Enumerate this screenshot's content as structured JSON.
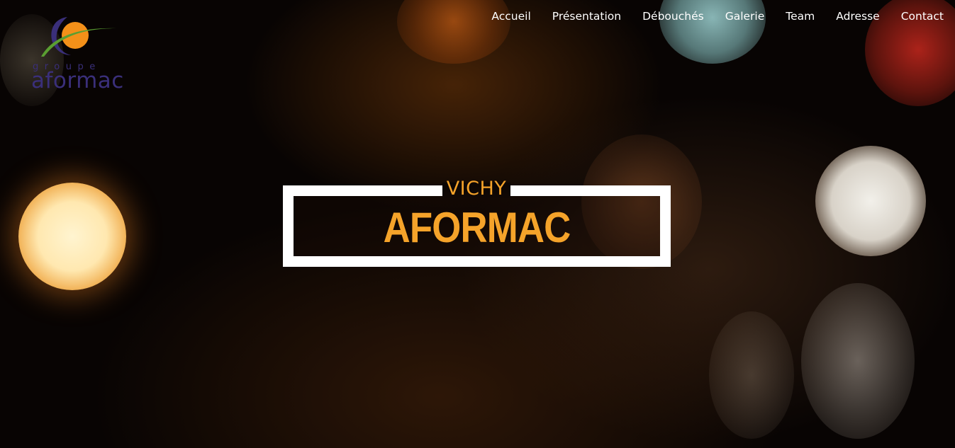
{
  "brand": {
    "groupe": "groupe",
    "name": "aformac",
    "colors": {
      "orange": "#f39019",
      "green": "#5a9e32",
      "purple": "#3a2f7a"
    }
  },
  "nav": {
    "items": [
      {
        "label": "Accueil"
      },
      {
        "label": "Présentation"
      },
      {
        "label": "Débouchés"
      },
      {
        "label": "Galerie"
      },
      {
        "label": "Team"
      },
      {
        "label": "Adresse"
      },
      {
        "label": "Contact"
      }
    ]
  },
  "hero": {
    "subtitle": "VICHY",
    "title": "AFORMAC",
    "accent_color": "#f5a32a",
    "frame_color": "#ffffff"
  }
}
